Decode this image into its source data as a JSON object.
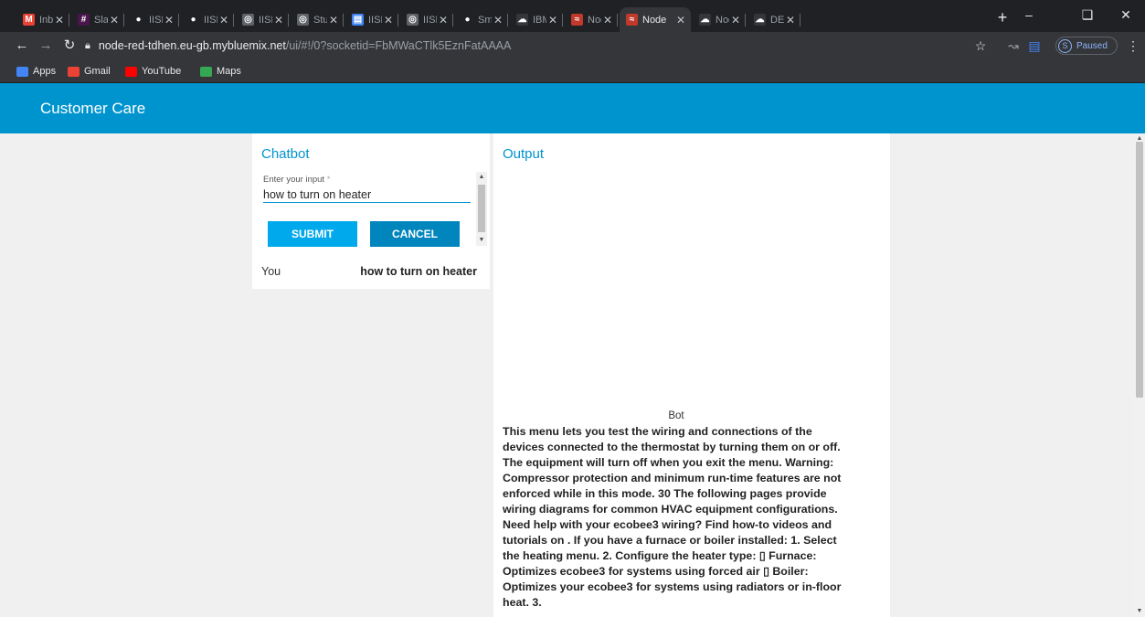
{
  "browser": {
    "tabs": [
      {
        "title": "Inbox",
        "icon": "gmail-icon",
        "color": "#ea4335",
        "glyph": "M"
      },
      {
        "title": "Slack",
        "icon": "slack-icon",
        "color": "#4a154b",
        "glyph": "#"
      },
      {
        "title": "IISPS",
        "icon": "github-icon",
        "color": "#202124",
        "glyph": "●"
      },
      {
        "title": "IISPS",
        "icon": "github-icon",
        "color": "#202124",
        "glyph": "●"
      },
      {
        "title": "IISPS",
        "icon": "globe-icon",
        "color": "#5f6368",
        "glyph": "◎"
      },
      {
        "title": "Stude",
        "icon": "globe-icon",
        "color": "#5f6368",
        "glyph": "◎"
      },
      {
        "title": "IISPS",
        "icon": "document-icon",
        "color": "#4285f4",
        "glyph": "▤"
      },
      {
        "title": "IISPS",
        "icon": "globe-icon",
        "color": "#5f6368",
        "glyph": "◎"
      },
      {
        "title": "Smar",
        "icon": "github-icon",
        "color": "#202124",
        "glyph": "●"
      },
      {
        "title": "IBM /",
        "icon": "ibm-cloud-icon",
        "color": "#35363a",
        "glyph": "☁"
      },
      {
        "title": "Node",
        "icon": "node-red-icon",
        "color": "#c0392b",
        "glyph": "≈"
      },
      {
        "title": "Node",
        "icon": "node-red-icon",
        "color": "#c0392b",
        "glyph": "≈",
        "active": true
      },
      {
        "title": "Node",
        "icon": "ibm-cloud-icon",
        "color": "#35363a",
        "glyph": "☁"
      },
      {
        "title": "DEPL",
        "icon": "ibm-cloud-icon",
        "color": "#35363a",
        "glyph": "☁"
      }
    ],
    "url_host": "node-red-tdhen.eu-gb.mybluemix.net",
    "url_path": "/ui/#!/0?socketid=FbMWaCTlk5EznFatAAAA",
    "profile_initial": "S",
    "profile_status": "Paused",
    "bookmarks": [
      {
        "label": "Apps",
        "icon": "apps-grid-icon",
        "color": "#4285f4"
      },
      {
        "label": "Gmail",
        "icon": "gmail-icon",
        "color": "#ea4335"
      },
      {
        "label": "YouTube",
        "icon": "youtube-icon",
        "color": "#ff0000"
      },
      {
        "label": "Maps",
        "icon": "maps-pin-icon",
        "color": "#34a853"
      }
    ]
  },
  "app": {
    "title": "Customer Care",
    "accent": "#0094ce"
  },
  "chatbot": {
    "title": "Chatbot",
    "input_label": "Enter your input",
    "required_mark": "*",
    "input_value": "how to turn on heater",
    "submit_label": "SUBMIT",
    "cancel_label": "CANCEL",
    "message_sender": "You",
    "message_text": "how to turn on heater"
  },
  "output": {
    "title": "Output",
    "bot_label": "Bot",
    "bot_text": "This menu lets you test the wiring and connections of the devices connected to the thermostat by turning them on or off. The equipment will turn off when you exit the menu. Warning: Compressor protection and minimum run-time features are not enforced while in this mode. 30 The following pages provide wiring diagrams for common HVAC equipment configurations. Need help with your ecobee3 wiring? Find how-to videos and tutorials on . If you have a furnace or boiler installed: 1. Select the heating menu. 2. Configure the heater type: ▯ Furnace: Optimizes ecobee3 for systems using forced air ▯ Boiler: Optimizes your ecobee3 for systems using radiators or in-floor heat. 3."
  }
}
